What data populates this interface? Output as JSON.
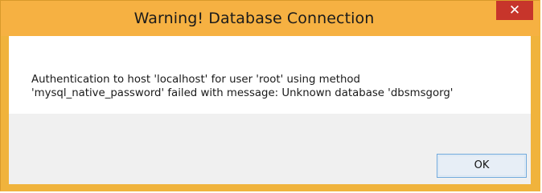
{
  "window": {
    "title": "Warning! Database Connection",
    "close_glyph": "✕"
  },
  "message": {
    "line1": "Authentication to host 'localhost' for user 'root' using method",
    "line2": "'mysql_native_password' failed with message: Unknown database 'dbsmsgorg'"
  },
  "buttons": {
    "ok_label": "OK"
  },
  "colors": {
    "titlebar": "#f6b142",
    "close_button": "#c7352b",
    "content_background": "#ffffff",
    "footer_background": "#f0f0f0",
    "ok_border": "#6fa9dd"
  }
}
